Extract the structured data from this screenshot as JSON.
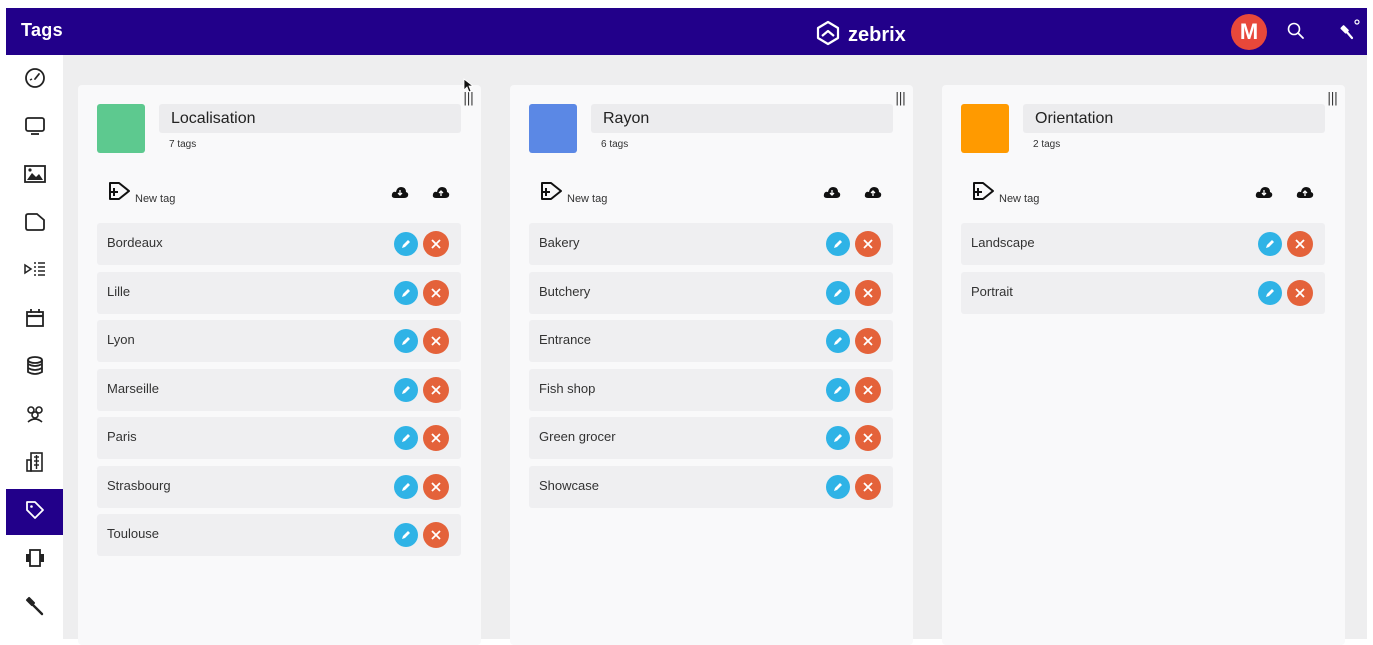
{
  "header": {
    "title": "Tags",
    "brand": "zebrix",
    "avatar_letter": "M"
  },
  "colors": {
    "primary": "#22008a",
    "edit": "#2fb3e6",
    "delete": "#e4623a"
  },
  "sidebar": {
    "items": [
      {
        "icon": "dashboard-icon"
      },
      {
        "icon": "monitor-icon"
      },
      {
        "icon": "image-icon"
      },
      {
        "icon": "folder-icon"
      },
      {
        "icon": "playlist-icon"
      },
      {
        "icon": "calendar-icon"
      },
      {
        "icon": "database-icon"
      },
      {
        "icon": "users-icon"
      },
      {
        "icon": "building-icon"
      },
      {
        "icon": "tag-icon",
        "active": true
      },
      {
        "icon": "device-icon"
      },
      {
        "icon": "tools-icon"
      }
    ]
  },
  "groups": [
    {
      "name": "Localisation",
      "count": "7 tags",
      "color": "#5dc98f",
      "new_tag": "New tag",
      "tags": [
        "Bordeaux",
        "Lille",
        "Lyon",
        "Marseille",
        "Paris",
        "Strasbourg",
        "Toulouse"
      ]
    },
    {
      "name": "Rayon",
      "count": "6 tags",
      "color": "#5b88e5",
      "new_tag": "New tag",
      "tags": [
        "Bakery",
        "Butchery",
        "Entrance",
        "Fish shop",
        "Green grocer",
        "Showcase"
      ]
    },
    {
      "name": "Orientation",
      "count": "2 tags",
      "color": "#ff9a00",
      "new_tag": "New tag",
      "tags": [
        "Landscape",
        "Portrait"
      ]
    }
  ]
}
